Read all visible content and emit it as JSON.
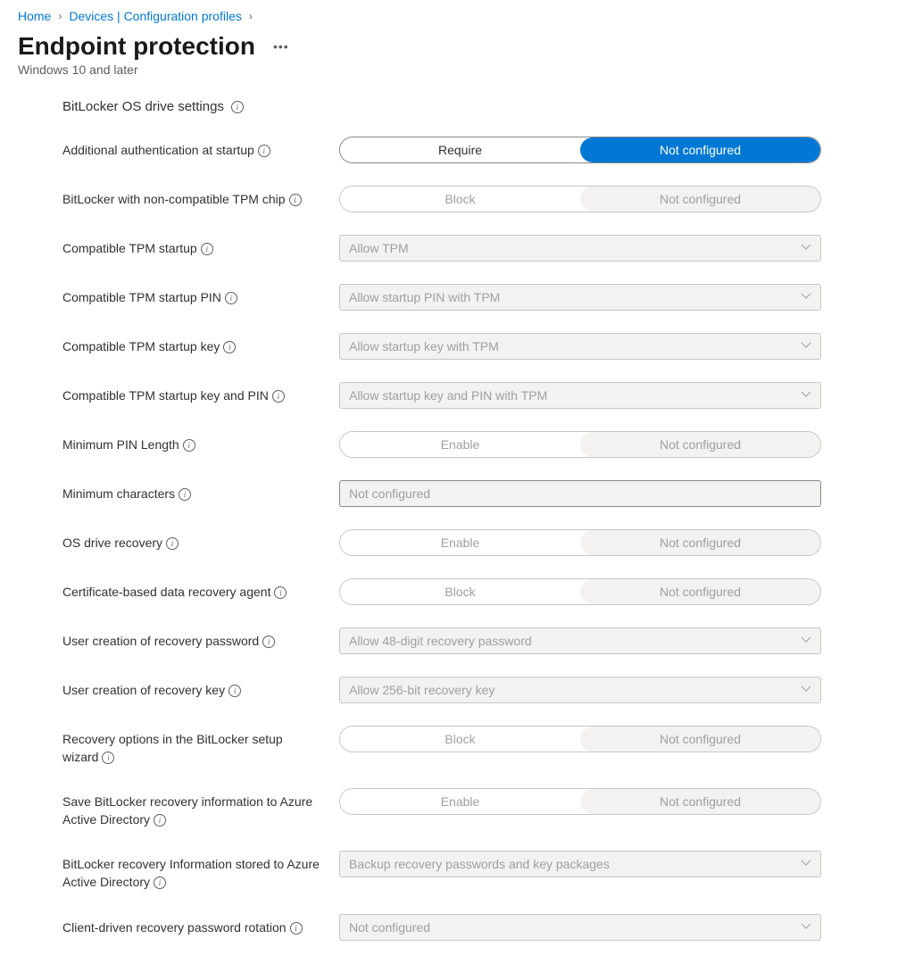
{
  "breadcrumb": {
    "home": "Home",
    "devices": "Devices | Configuration profiles"
  },
  "page": {
    "title": "Endpoint protection",
    "subtitle": "Windows 10 and later"
  },
  "section": {
    "header": "BitLocker OS drive settings"
  },
  "settings": {
    "auth_startup": {
      "label": "Additional authentication at startup",
      "option1": "Require",
      "option2": "Not configured"
    },
    "non_compat_tpm": {
      "label": "BitLocker with non-compatible TPM chip",
      "option1": "Block",
      "option2": "Not configured"
    },
    "compat_tpm_startup": {
      "label": "Compatible TPM startup",
      "value": "Allow TPM"
    },
    "compat_tpm_pin": {
      "label": "Compatible TPM startup PIN",
      "value": "Allow startup PIN with TPM"
    },
    "compat_tpm_key": {
      "label": "Compatible TPM startup key",
      "value": "Allow startup key with TPM"
    },
    "compat_tpm_key_pin": {
      "label": "Compatible TPM startup key and PIN",
      "value": "Allow startup key and PIN with TPM"
    },
    "min_pin_length": {
      "label": "Minimum PIN Length",
      "option1": "Enable",
      "option2": "Not configured"
    },
    "min_chars": {
      "label": "Minimum characters",
      "value": "Not configured"
    },
    "os_drive_recovery": {
      "label": "OS drive recovery",
      "option1": "Enable",
      "option2": "Not configured"
    },
    "cert_recovery_agent": {
      "label": "Certificate-based data recovery agent",
      "option1": "Block",
      "option2": "Not configured"
    },
    "user_recovery_password": {
      "label": "User creation of recovery password",
      "value": "Allow 48-digit recovery password"
    },
    "user_recovery_key": {
      "label": "User creation of recovery key",
      "value": "Allow 256-bit recovery key"
    },
    "recovery_options_wizard": {
      "label": "Recovery options in the BitLocker setup wizard",
      "option1": "Block",
      "option2": "Not configured"
    },
    "save_recovery_aad": {
      "label": "Save BitLocker recovery information to Azure Active Directory",
      "option1": "Enable",
      "option2": "Not configured"
    },
    "recovery_info_stored": {
      "label": "BitLocker recovery Information stored to Azure Active Directory",
      "value": "Backup recovery passwords and key packages"
    },
    "client_rotation": {
      "label": "Client-driven recovery password rotation",
      "value": "Not configured"
    }
  }
}
